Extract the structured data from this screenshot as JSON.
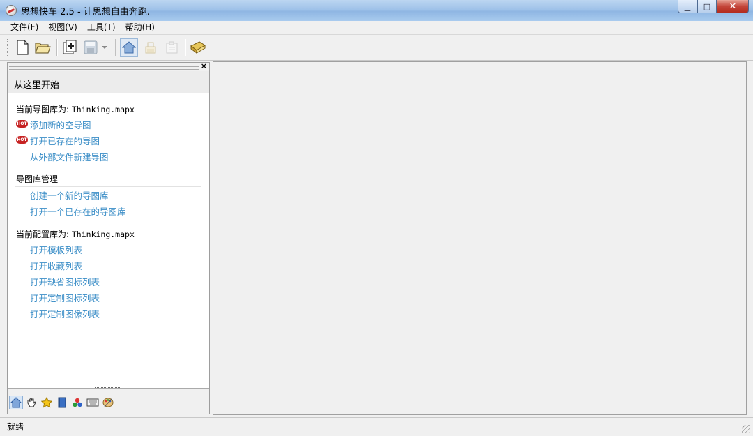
{
  "window": {
    "title": "思想快车 2.5 - 让思想自由奔跑.",
    "minimize_glyph": "▁",
    "maximize_glyph": "□",
    "close_glyph": "✕"
  },
  "menu": [
    {
      "label": "文件(F)"
    },
    {
      "label": "视图(V)"
    },
    {
      "label": "工具(T)"
    },
    {
      "label": "帮助(H)"
    }
  ],
  "toolbar": {
    "icons": [
      "new-document-icon",
      "open-folder-icon",
      "add-map-icon",
      "save-disk-icon",
      "dropdown-arrow-icon",
      "home-icon",
      "format-icon",
      "export-icon",
      "library-book-icon"
    ]
  },
  "panel": {
    "close_glyph": "×",
    "start_label": "从这里开始",
    "hot_badge": "HOT",
    "sections": [
      {
        "title": "当前导图库为:",
        "file": "Thinking.mapx",
        "links": [
          "添加新的空导图",
          "打开已存在的导图",
          "从外部文件新建导图"
        ]
      },
      {
        "title": "导图库管理",
        "file": "",
        "links": [
          "创建一个新的导图库",
          "打开一个已存在的导图库"
        ]
      },
      {
        "title": "当前配置库为:",
        "file": "Thinking.mapx",
        "links": [
          "打开模板列表",
          "打开收藏列表",
          "打开缺省图标列表",
          "打开定制图标列表",
          "打开定制图像列表"
        ]
      }
    ],
    "footer_icons": [
      "home-icon",
      "hand-icon",
      "star-icon",
      "book-icon",
      "color-balls-icon",
      "keyboard-icon",
      "palette-icon"
    ]
  },
  "status": {
    "text": "就绪"
  },
  "colors": {
    "link": "#3b8ec7",
    "hot_badge": "#c62222",
    "title_bar": "#9fc2e9"
  }
}
